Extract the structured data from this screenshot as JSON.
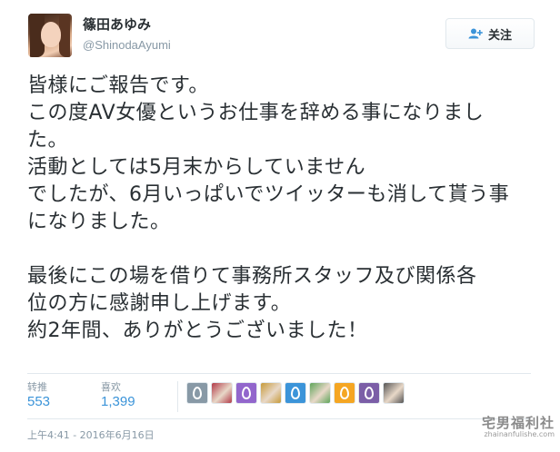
{
  "profile": {
    "display_name": "篠田あゆみ",
    "handle": "@ShinodaAyumi",
    "avatar": "avatar-photo"
  },
  "follow_button": {
    "label": "关注",
    "icon": "add-user-icon"
  },
  "tweet": {
    "lines": [
      "皆様にご報告です。",
      "この度AV女優というお仕事を辞める事になりまし",
      "た。",
      "活動としては5月末からしていません",
      "でしたが、6月いっぱいでツイッターも消して貰う事",
      "になりました。",
      "",
      "最後にこの場を借りて事務所スタッフ及び関係各",
      "位の方に感謝申し上げます。",
      "約2年間、ありがとうございました！"
    ]
  },
  "stats": {
    "retweets_label": "转推",
    "retweets_value": "553",
    "likes_label": "喜欢",
    "likes_value": "1,399"
  },
  "likers": [
    {
      "name": "default-egg-avatar",
      "color": "#8899a6"
    },
    {
      "name": "flag-avatar",
      "color": "#b23a48"
    },
    {
      "name": "default-egg-avatar",
      "color": "#9266cc"
    },
    {
      "name": "anime-avatar",
      "color": "#c79a3a"
    },
    {
      "name": "default-egg-avatar",
      "color": "#3b94d9"
    },
    {
      "name": "character-avatar",
      "color": "#5fa55a"
    },
    {
      "name": "default-egg-avatar",
      "color": "#f5a623"
    },
    {
      "name": "default-egg-avatar",
      "color": "#7b5ea7"
    },
    {
      "name": "photo-avatar",
      "color": "#555555"
    }
  ],
  "timestamp": "上午4:41 - 2016年6月16日",
  "watermark": {
    "text": "宅男福利社",
    "sub": "zhainanfulishe.com"
  },
  "colors": {
    "link_blue": "#3b94d9",
    "muted_gray": "#8899a6",
    "text": "#292f33",
    "border": "#e1e8ed"
  }
}
